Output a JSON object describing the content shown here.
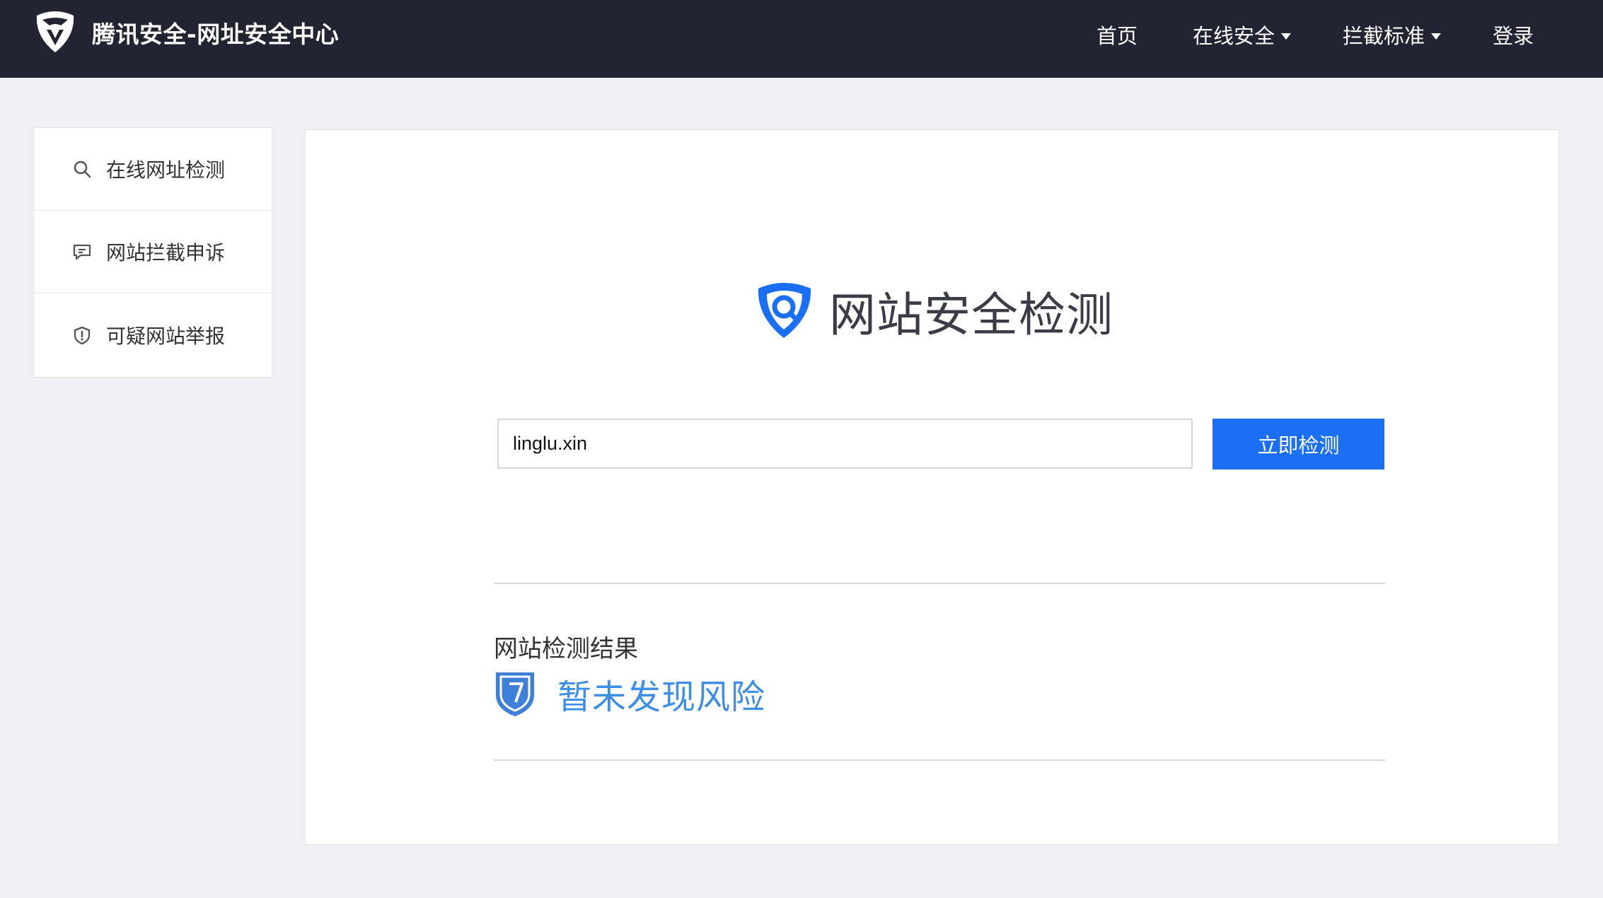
{
  "header": {
    "title": "腾讯安全-网址安全中心",
    "nav": [
      {
        "label": "首页",
        "has_dropdown": false
      },
      {
        "label": "在线安全",
        "has_dropdown": true
      },
      {
        "label": "拦截标准",
        "has_dropdown": true
      },
      {
        "label": "登录",
        "has_dropdown": false
      }
    ]
  },
  "sidebar": {
    "items": [
      {
        "label": "在线网址检测",
        "icon": "search-icon"
      },
      {
        "label": "网站拦截申诉",
        "icon": "comment-icon"
      },
      {
        "label": "可疑网站举报",
        "icon": "shield-alert-icon"
      }
    ]
  },
  "main": {
    "hero_title": "网站安全检测",
    "search": {
      "value": "linglu.xin"
    },
    "check_button": "立即检测",
    "result": {
      "label": "网站检测结果",
      "status": "暂未发现风险"
    }
  },
  "colors": {
    "topbar": "#222432",
    "primary": "#1b6ff5",
    "result_text": "#3d8ee6",
    "background": "#f0f0f4"
  }
}
